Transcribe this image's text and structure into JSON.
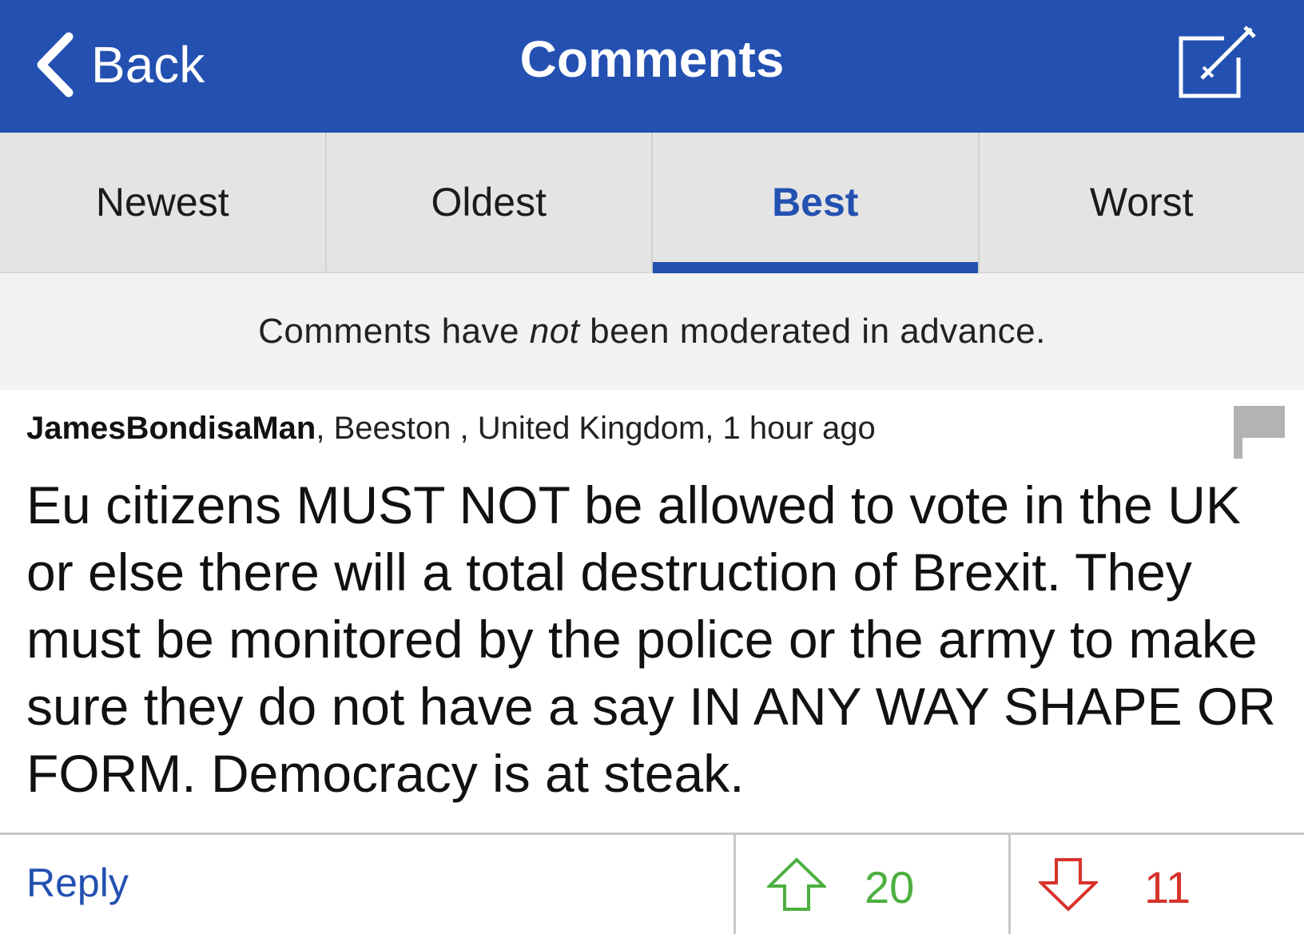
{
  "header": {
    "back_label": "Back",
    "title": "Comments"
  },
  "tabs": [
    {
      "label": "Newest",
      "active": false
    },
    {
      "label": "Oldest",
      "active": false
    },
    {
      "label": "Best",
      "active": true
    },
    {
      "label": "Worst",
      "active": false
    }
  ],
  "notice": {
    "before": "Comments have ",
    "emphasis": "not",
    "after": " been moderated in advance."
  },
  "comment": {
    "author": "JamesBondisaMan",
    "location_time": ", Beeston , United Kingdom, 1 hour ago",
    "body": "Eu citizens MUST NOT be allowed to vote in the UK or else there will a total destruction of Brexit. They must be monitored by the police or the army to make sure they do not have a say IN ANY WAY SHAPE OR FORM. Democracy is at steak.",
    "reply_label": "Reply",
    "upvotes": "20",
    "downvotes": "11"
  },
  "colors": {
    "brand": "#2350b1",
    "upvote": "#4caf3f",
    "downvote": "#d8322c"
  },
  "icons": [
    "chevron-left-icon",
    "compose-icon",
    "flag-icon",
    "arrow-up-icon",
    "arrow-down-icon"
  ]
}
